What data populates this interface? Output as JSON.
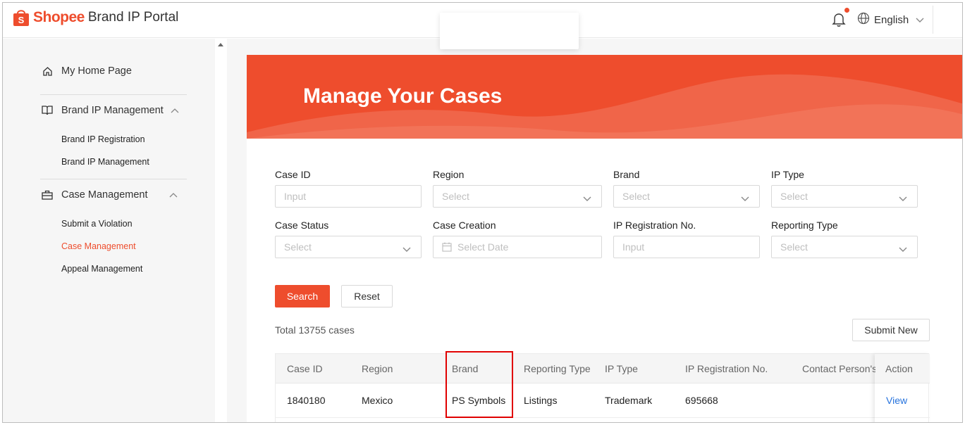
{
  "header": {
    "logo_word": "Shopee",
    "portal_title": "Brand IP Portal",
    "language": "English"
  },
  "sidebar": {
    "home": "My Home Page",
    "groups": [
      {
        "label": "Brand IP Management",
        "items": [
          "Brand IP Registration",
          "Brand IP Management"
        ]
      },
      {
        "label": "Case Management",
        "items": [
          "Submit a Violation",
          "Case Management",
          "Appeal Management"
        ]
      }
    ],
    "active_item": "Case Management"
  },
  "banner": {
    "title": "Manage Your Cases"
  },
  "filters": {
    "case_id": {
      "label": "Case ID",
      "placeholder": "Input"
    },
    "region": {
      "label": "Region",
      "placeholder": "Select"
    },
    "brand": {
      "label": "Brand",
      "placeholder": "Select"
    },
    "ip_type": {
      "label": "IP Type",
      "placeholder": "Select"
    },
    "case_status": {
      "label": "Case Status",
      "placeholder": "Select"
    },
    "case_creation": {
      "label": "Case Creation",
      "placeholder": "Select Date"
    },
    "ip_registration_no": {
      "label": "IP Registration No.",
      "placeholder": "Input"
    },
    "reporting_type": {
      "label": "Reporting Type",
      "placeholder": "Select"
    }
  },
  "actions": {
    "search": "Search",
    "reset": "Reset",
    "submit_new": "Submit New"
  },
  "total_text": "Total 13755 cases",
  "table": {
    "columns": [
      "Case ID",
      "Region",
      "Brand",
      "Reporting Type",
      "IP Type",
      "IP Registration No.",
      "Contact Person's",
      "Action"
    ],
    "rows": [
      {
        "case_id": "1840180",
        "region": "Mexico",
        "brand": "PS Symbols",
        "reporting_type": "Listings",
        "ip_type": "Trademark",
        "ip_reg_no": "695668",
        "contact": "",
        "action": "View"
      }
    ]
  },
  "colors": {
    "brand": "#ee4d2d",
    "link": "#2673dd",
    "highlight": "#e00000"
  }
}
